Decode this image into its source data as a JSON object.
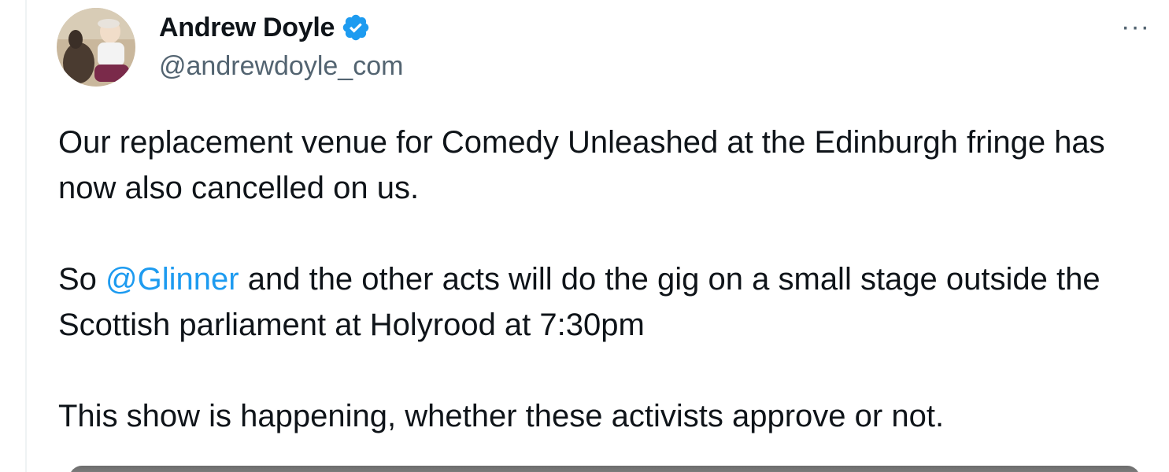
{
  "tweet": {
    "author": {
      "display_name": "Andrew Doyle",
      "handle": "@andrewdoyle_com",
      "verified": true
    },
    "more_label": "···",
    "text": {
      "p1": "Our replacement venue for Comedy Unleashed at the Edinburgh fringe has now also cancelled on us.",
      "p2_prefix": "So ",
      "p2_mention": "@Glinner",
      "p2_suffix": " and the other acts will do the gig on a small stage outside the Scottish parliament at Holyrood at 7:30pm",
      "p3": "This show is happening, whether these activists approve or not."
    }
  },
  "colors": {
    "accent": "#1d9bf0",
    "text": "#0f1419",
    "secondary": "#536471"
  },
  "icons": {
    "verified": "verified-badge-icon",
    "more": "more-options-icon"
  }
}
